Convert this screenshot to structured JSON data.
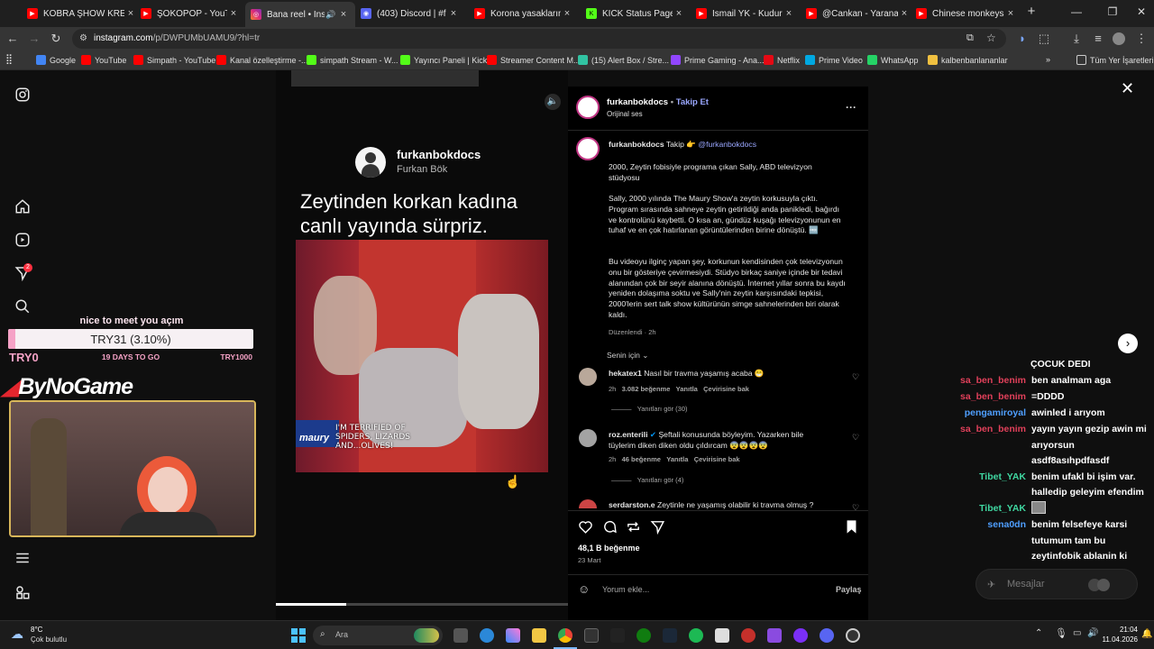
{
  "browser": {
    "tabs": [
      {
        "title": "KOBRA ŞHOW KREMİ",
        "icon": "youtube-icon",
        "active": false
      },
      {
        "title": "ŞOKOPOP - YouTube",
        "icon": "youtube-icon",
        "active": false
      },
      {
        "title": "Bana reel • Instagr",
        "icon": "instagram-icon",
        "active": true
      },
      {
        "title": "(403) Discord | #f",
        "icon": "discord-icon",
        "active": false
      },
      {
        "title": "Korona yasaklarında",
        "icon": "youtube-icon",
        "active": false
      },
      {
        "title": "KICK Status Page",
        "icon": "kick-icon",
        "active": false
      },
      {
        "title": "İsmail YK - Kudur Bab",
        "icon": "youtube-icon",
        "active": false
      },
      {
        "title": "@Cankan - Yaranama",
        "icon": "youtube-icon",
        "active": false
      },
      {
        "title": "Chinese monkeys sin",
        "icon": "youtube-icon",
        "active": false
      }
    ],
    "url_host": "instagram.com",
    "url_path": "/p/DWPUMbUAMU9/?hl=tr",
    "bookmarks": [
      {
        "label": "Google",
        "color": "#4285f4"
      },
      {
        "label": "YouTube",
        "color": "#ff0000"
      },
      {
        "label": "Simpath - YouTube",
        "color": "#ff0000"
      },
      {
        "label": "Kanal özelleştirme -...",
        "color": "#ff0000"
      },
      {
        "label": "simpath Stream - W...",
        "color": "#53fc18"
      },
      {
        "label": "Yayıncı Paneli | Kick",
        "color": "#53fc18"
      },
      {
        "label": "Streamer Content M...",
        "color": "#ff0000"
      },
      {
        "label": "(15) Alert Box / Stre...",
        "color": "#31c3a2"
      },
      {
        "label": "Prime Gaming - Ana...",
        "color": "#9146ff"
      },
      {
        "label": "Netflix",
        "color": "#e50914"
      },
      {
        "label": "Prime Video",
        "color": "#00a8e1"
      },
      {
        "label": "WhatsApp",
        "color": "#25d366"
      },
      {
        "label": "kalbenbanlananlar",
        "color": "#f0c040"
      }
    ],
    "all_bookmarks": "Tüm Yer İşaretleri"
  },
  "video": {
    "creator_handle": "furkanbokdocs",
    "creator_name": "Furkan Bök",
    "caption_line1": "Zeytinden korkan kadına",
    "caption_line2": "canlı yayında sürpriz.",
    "subtitle_line1": "I'M TERRIFIED OF",
    "subtitle_line2": "SPIDERS, LIZARDS",
    "subtitle_line3": "AND...OLIVES!",
    "show_logo": "maury",
    "progress": 0.24
  },
  "post": {
    "username": "furkanbokdocs",
    "follow": "Takip Et",
    "audio": "Orijinal ses",
    "caption_user": "furkanbokdocs",
    "caption_follow": "Takip",
    "caption_mention": "@furkanbokdocs",
    "para1": "2000, Zeytin fobisiyle programa çıkan Sally, ABD televizyon stüdyosu",
    "para2": "Sally, 2000 yılında The Maury Show'a zeytin korkusuyla çıktı. Program sırasında sahneye zeytin getirildiği anda panikledi, bağırdı ve kontrolünü kaybetti. O kısa an, gündüz kuşağı televizyonunun en tuhaf ve en çok hatırlanan görüntülerinden birine dönüştü. 🆓",
    "para3": "Bu videoyu ilginç yapan şey, korkunun kendisinden çok televizyonun onu bir gösteriye çevirmesiydi. Stüdyo birkaç saniye içinde bir tedavi alanından çok bir seyir alanına dönüştü. İnternet yıllar sonra bu kaydı yeniden dolaşıma soktu ve Sally'nin zeytin karşısındaki tepkisi, 2000'lerin sert talk show kültürünün simge sahnelerinden biri olarak kaldı.",
    "edited": "Düzenlendi · 2h",
    "sort": "Senin için",
    "comments": [
      {
        "user": "hekatex1",
        "text": "Nasıl bir travma yaşamış acaba 😁",
        "time": "2h",
        "likes": "3.082 beğenme",
        "reply": "Yanıtla",
        "translate": "Çevirisine bak",
        "view_replies": "Yanıtları gör (30)"
      },
      {
        "user": "roz.enterili",
        "text": "Şeftali konusunda böyleyim. Yazarken bile tüylerim diken diken oldu çıldırcam 😨😨😨😨",
        "time": "2h",
        "likes": "46 beğenme",
        "reply": "Yanıtla",
        "translate": "Çevirisine bak",
        "view_replies": "Yanıtları gör (4)"
      },
      {
        "user": "serdarston.e",
        "text": "Zeytinle ne yaşamış olabilir ki travma olmuş ?"
      }
    ],
    "likes": "48,1 B beğenme",
    "date": "23 Mart",
    "comment_placeholder": "Yorum ekle...",
    "share": "Paylaş"
  },
  "stream_overlay": {
    "greeting": "nice to meet you açım",
    "goal_text": "TRY31 (3.10%)",
    "goal_fraction": 0.031,
    "goal_start": "TRY0",
    "goal_days": "19 DAYS TO GO",
    "goal_end": "TRY1000",
    "brand": "ByNoGame",
    "chat_header": "ÇOCUK DEDI",
    "chat": [
      {
        "user": "sa_ben_benim",
        "color": "#e0405a",
        "msg": "ben analmam aga"
      },
      {
        "user": "sa_ben_benim",
        "color": "#e0405a",
        "msg": "=DDDD"
      },
      {
        "user": "pengamiroyal",
        "color": "#4f9fff",
        "msg": "awinled i arıyom"
      },
      {
        "user": "sa_ben_benim",
        "color": "#e0405a",
        "msg": "yayın yayın gezip awin mi"
      },
      {
        "user": "",
        "color": "#ffffff",
        "msg": "arıyorsun"
      },
      {
        "user": "",
        "color": "#ffffff",
        "msg": "asdf8asıhpdfasdf"
      },
      {
        "user": "Tibet_YAK",
        "color": "#3fd6a0",
        "msg": "benim ufakl bi işim var."
      },
      {
        "user": "",
        "color": "#ffffff",
        "msg": "halledip geleyim efendim"
      },
      {
        "user": "Tibet_YAK",
        "color": "#3fd6a0",
        "msg": ""
      },
      {
        "user": "sena0dn",
        "color": "#4f9fff",
        "msg": "benim felsefeye karsi"
      },
      {
        "user": "",
        "color": "#ffffff",
        "msg": "tutumum tam bu"
      },
      {
        "user": "",
        "color": "#ffffff",
        "msg": "zeytinfobik ablanin ki"
      }
    ],
    "messages_label": "Mesajlar",
    "notif_count": "2"
  },
  "taskbar": {
    "temp": "8°C",
    "weather": "Çok bulutlu",
    "search": "Ara",
    "time": "21:04",
    "date": "11.04.2026"
  },
  "colors": {
    "accent_link": "#9aa7ff",
    "ig_blue": "#0095f6"
  }
}
